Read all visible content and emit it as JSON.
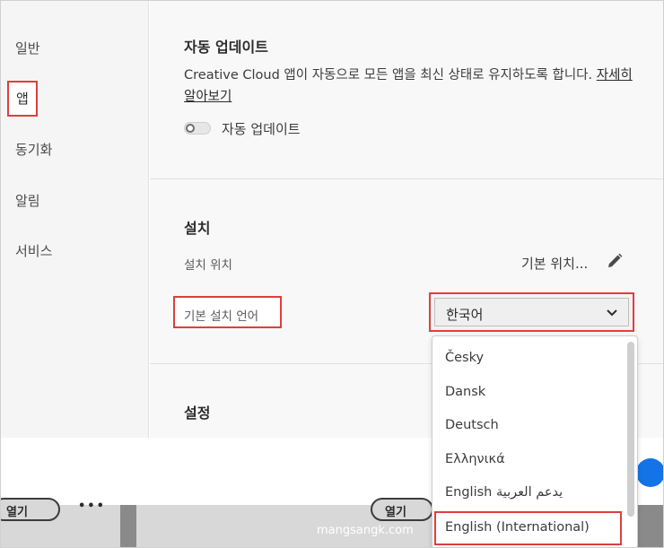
{
  "sidebar": {
    "items": [
      {
        "label": "일반"
      },
      {
        "label": "앱",
        "active": true
      },
      {
        "label": "동기화"
      },
      {
        "label": "알림"
      },
      {
        "label": "서비스"
      }
    ]
  },
  "auto_update": {
    "title": "자동 업데이트",
    "description": "Creative Cloud 앱이 자동으로 모든 앱을 최신 상태로 유지하도록 합니다.",
    "learn_more": "자세히 알아보기",
    "toggle_label": "자동 업데이트",
    "toggle_on": false
  },
  "install": {
    "title": "설치",
    "location_label": "설치 위치",
    "location_value": "기본 위치...",
    "language_label": "기본 설치 언어",
    "language_value": "한국어"
  },
  "settings": {
    "title": "설정"
  },
  "dropdown": {
    "options": [
      "Česky",
      "Dansk",
      "Deutsch",
      "Ελληνικά",
      "English يدعم العربية",
      "English (International)"
    ],
    "highlighted_index": 5
  },
  "bottom": {
    "pill_left_text": "열기",
    "pill_right_text": "열기",
    "dots": "•••"
  },
  "watermark": "mangsangk.com",
  "colors": {
    "highlight_red": "#e03e3e",
    "accent_blue": "#1473e6"
  }
}
